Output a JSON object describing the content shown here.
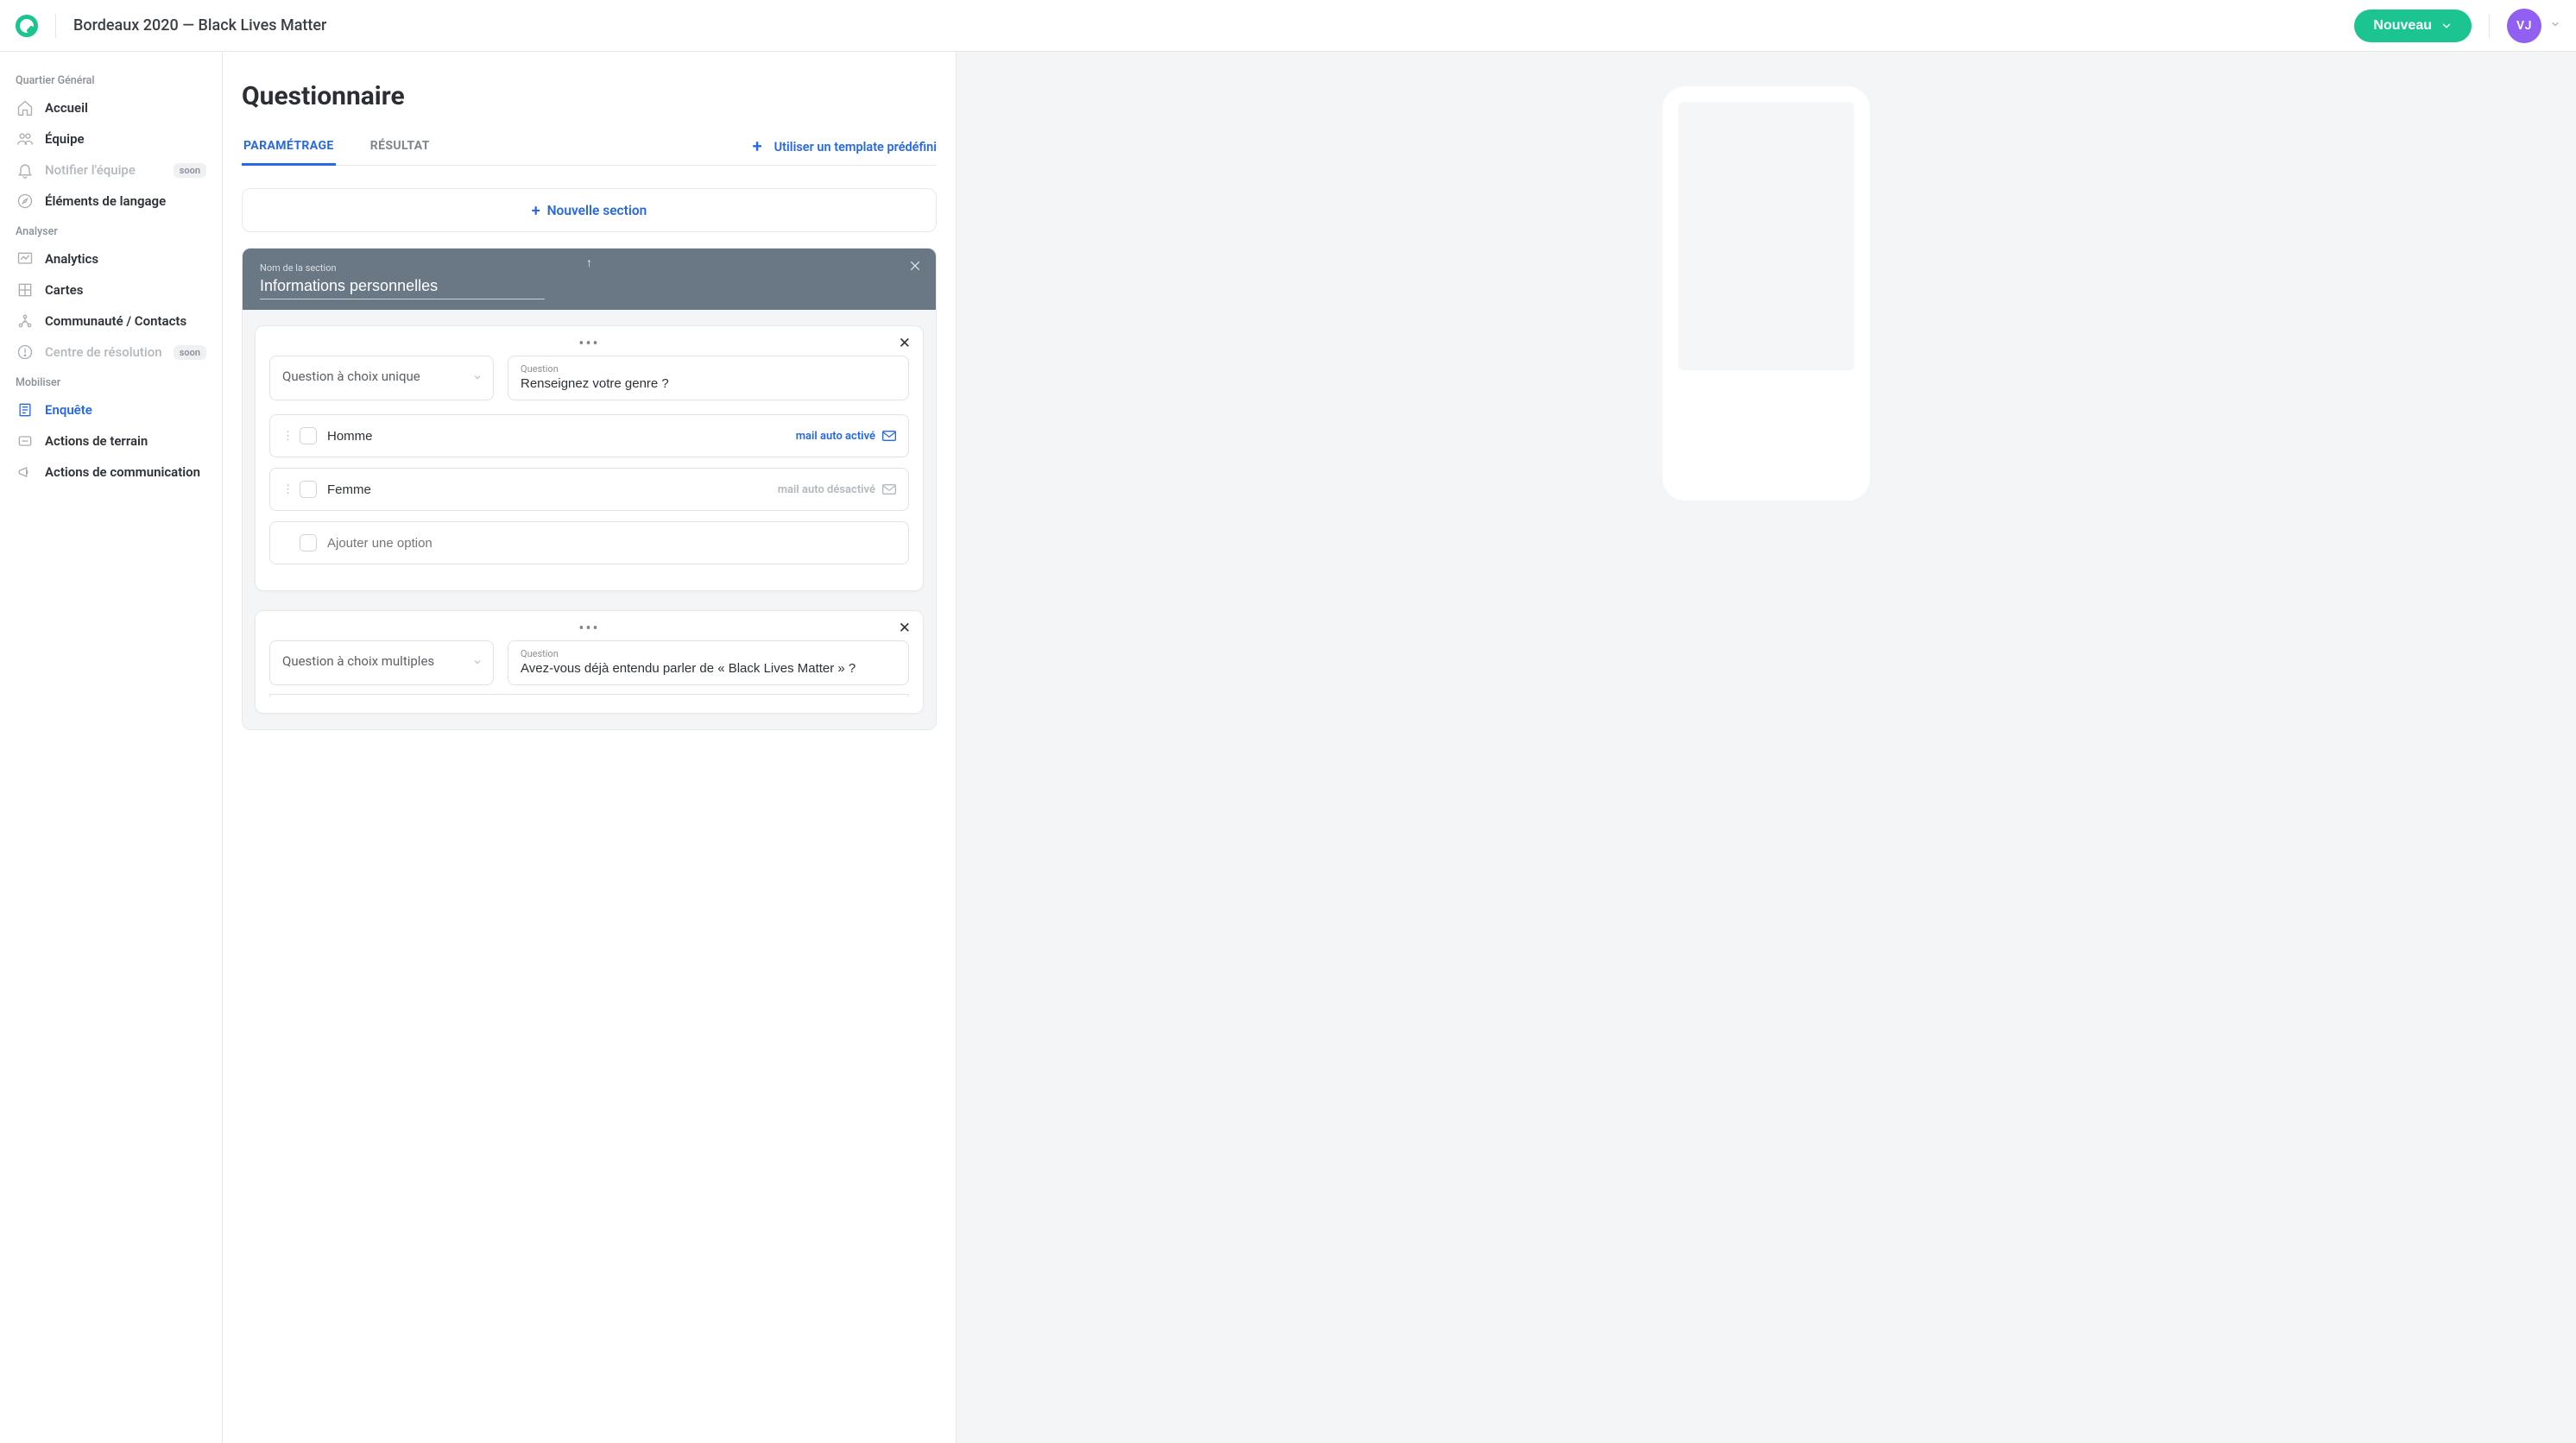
{
  "header": {
    "title": "Bordeaux 2020 — Black Lives Matter",
    "new_button": "Nouveau",
    "avatar_initials": "VJ"
  },
  "sidebar": {
    "groups": [
      {
        "title": "Quartier Général",
        "items": [
          {
            "id": "accueil",
            "label": "Accueil",
            "icon": "home",
            "disabled": false,
            "active": false
          },
          {
            "id": "equipe",
            "label": "Équipe",
            "icon": "users",
            "disabled": false,
            "active": false
          },
          {
            "id": "notifier",
            "label": "Notifier l'équipe",
            "icon": "bell",
            "disabled": true,
            "active": false,
            "badge": "soon"
          },
          {
            "id": "elements",
            "label": "Éléments de langage",
            "icon": "compass",
            "disabled": false,
            "active": false
          }
        ]
      },
      {
        "title": "Analyser",
        "items": [
          {
            "id": "analytics",
            "label": "Analytics",
            "icon": "chart",
            "disabled": false,
            "active": false
          },
          {
            "id": "cartes",
            "label": "Cartes",
            "icon": "map",
            "disabled": false,
            "active": false
          },
          {
            "id": "communaute",
            "label": "Communauté / Contacts",
            "icon": "network",
            "disabled": false,
            "active": false
          },
          {
            "id": "centre",
            "label": "Centre de résolution",
            "icon": "alert",
            "disabled": true,
            "active": false,
            "badge": "soon"
          }
        ]
      },
      {
        "title": "Mobiliser",
        "items": [
          {
            "id": "enquete",
            "label": "Enquête",
            "icon": "form",
            "disabled": false,
            "active": true
          },
          {
            "id": "terrain",
            "label": "Actions de terrain",
            "icon": "megaphone",
            "disabled": false,
            "active": false
          },
          {
            "id": "comm",
            "label": "Actions de communication",
            "icon": "announce",
            "disabled": false,
            "active": false
          }
        ]
      }
    ]
  },
  "main": {
    "page_title": "Questionnaire",
    "tabs": [
      {
        "label": "PARAMÉTRAGE",
        "active": true
      },
      {
        "label": "RÉSULTAT",
        "active": false
      }
    ],
    "template_link": "Utiliser un template prédéfini",
    "new_section": "Nouvelle section",
    "section": {
      "name_label": "Nom de la section",
      "name_value": "Informations personnelles"
    },
    "questions": [
      {
        "type_label": "Question à choix unique",
        "question_label": "Question",
        "question_value": "Renseignez votre genre ?",
        "options": [
          {
            "text": "Homme",
            "mail_label": "mail auto activé",
            "mail_active": true
          },
          {
            "text": "Femme",
            "mail_label": "mail auto désactivé",
            "mail_active": false
          }
        ],
        "add_option_placeholder": "Ajouter une option"
      },
      {
        "type_label": "Question à choix multiples",
        "question_label": "Question",
        "question_value": "Avez-vous déjà entendu parler de « Black Lives Matter » ?"
      }
    ]
  }
}
